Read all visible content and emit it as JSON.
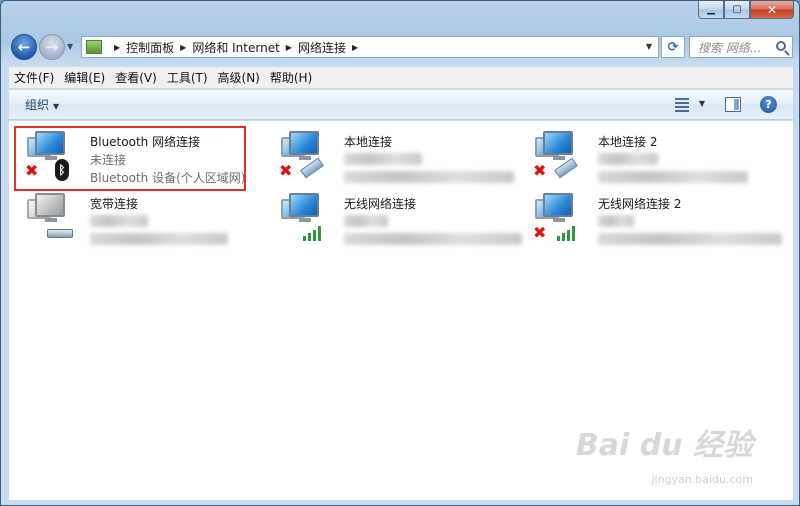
{
  "caption": {
    "minimize": "▁",
    "maximize": "▢",
    "close": "✕"
  },
  "nav": {
    "back": "←",
    "forward": "→"
  },
  "address": {
    "crumbs": [
      "控制面板",
      "网络和 Internet",
      "网络连接"
    ]
  },
  "search": {
    "placeholder": "搜索 网络..."
  },
  "menu": [
    "文件(F)",
    "编辑(E)",
    "查看(V)",
    "工具(T)",
    "高级(N)",
    "帮助(H)"
  ],
  "toolbar": {
    "organize": "组织",
    "help": "?"
  },
  "connections": [
    {
      "name": "Bluetooth 网络连接",
      "status": "未连接",
      "device": "Bluetooth 设备(个人区域网)",
      "icon": "bluetooth-icon",
      "disconnected": true
    },
    {
      "name": "本地连接",
      "status": "",
      "device": "",
      "icon": "ethernet-cable-icon",
      "disconnected": true
    },
    {
      "name": "本地连接 2",
      "status": "",
      "device": "",
      "icon": "ethernet-cable-icon",
      "disconnected": true
    },
    {
      "name": "宽带连接",
      "status": "",
      "device": "",
      "icon": "modem-icon",
      "disconnected": false
    },
    {
      "name": "无线网络连接",
      "status": "",
      "device": "",
      "icon": "wifi-signal-icon",
      "disconnected": false
    },
    {
      "name": "无线网络连接 2",
      "status": "",
      "device": "",
      "icon": "wifi-signal-icon",
      "disconnected": true
    }
  ],
  "watermark": {
    "logo": "Bai du 经验",
    "url": "jingyan.baidu.com"
  },
  "colors": {
    "highlight": "#e0302c",
    "disconnected": "#e01010",
    "accent": "#1f5cab"
  }
}
